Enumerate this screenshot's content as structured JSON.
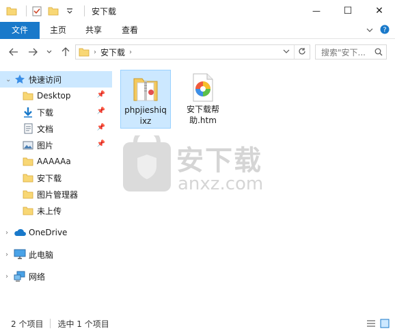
{
  "window": {
    "title": "安下载",
    "minimize_glyph": "—",
    "maximize_glyph": "☐",
    "close_glyph": "✕"
  },
  "ribbon": {
    "tabs": [
      "文件",
      "主页",
      "共享",
      "查看"
    ]
  },
  "address": {
    "path": "安下载",
    "search_placeholder": "搜索\"安下..."
  },
  "navpane": {
    "quick_access": "快速访问",
    "items": [
      {
        "label": "Desktop",
        "icon": "folder-icon",
        "pinned": true
      },
      {
        "label": "下载",
        "icon": "download-icon",
        "pinned": true
      },
      {
        "label": "文档",
        "icon": "document-icon",
        "pinned": true
      },
      {
        "label": "图片",
        "icon": "picture-icon",
        "pinned": true
      },
      {
        "label": "AAAAAa",
        "icon": "folder-icon",
        "pinned": false
      },
      {
        "label": "安下载",
        "icon": "folder-icon",
        "pinned": false
      },
      {
        "label": "图片管理器",
        "icon": "folder-icon",
        "pinned": false
      },
      {
        "label": "未上传",
        "icon": "folder-icon",
        "pinned": false
      }
    ],
    "onedrive": "OneDrive",
    "this_pc": "此电脑",
    "network": "网络"
  },
  "files": [
    {
      "name_line1": "phpjieshiq",
      "name_line2": "ixz",
      "type": "zip-folder-icon",
      "selected": true
    },
    {
      "name_line1": "安下载帮",
      "name_line2": "助.htm",
      "type": "htm-file-icon",
      "selected": false
    }
  ],
  "watermark": {
    "cn": "安下载",
    "domain": "anxz.com"
  },
  "status": {
    "count": "2 个项目",
    "selected": "选中 1 个项目"
  },
  "colors": {
    "accent": "#1979ca",
    "selection": "#cce8ff",
    "folder": "#f8d775"
  }
}
